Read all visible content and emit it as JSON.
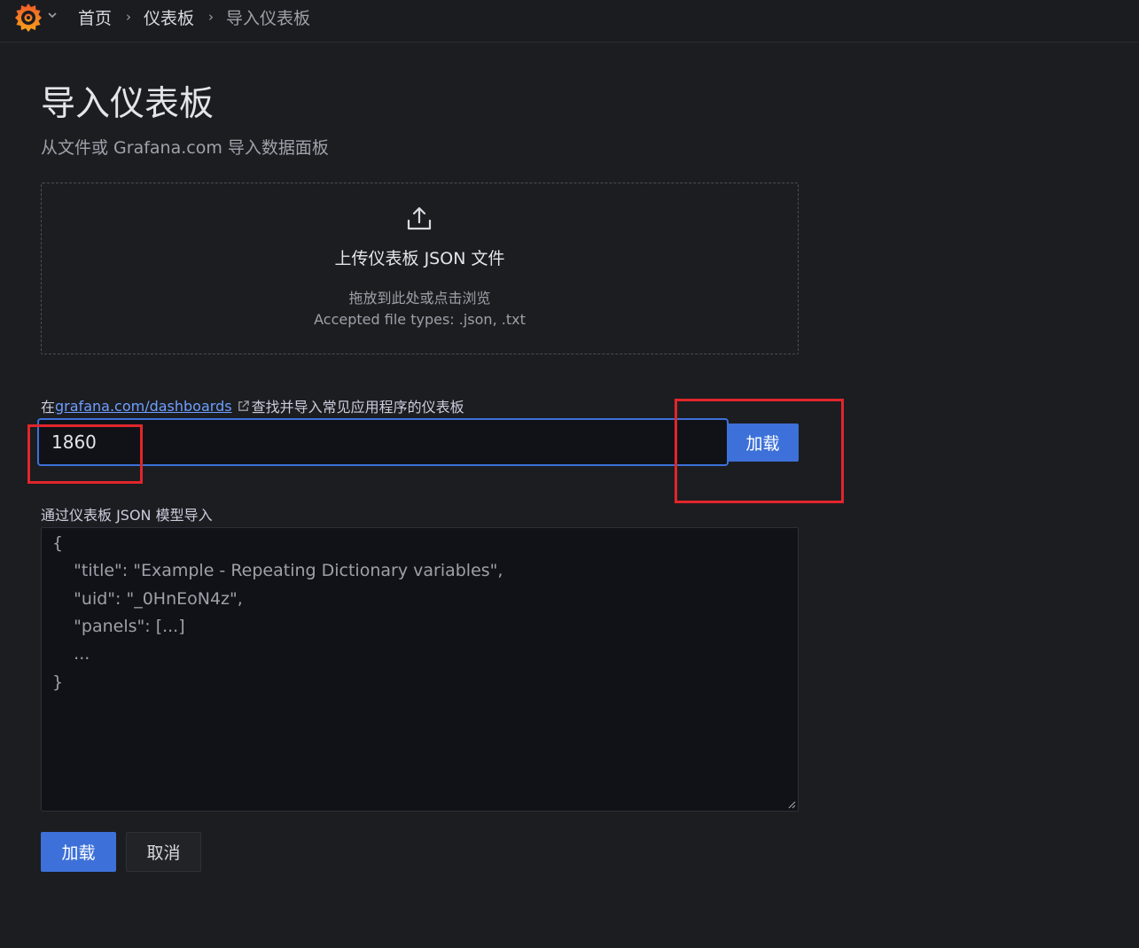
{
  "breadcrumb": {
    "items": [
      "首页",
      "仪表板",
      "导入仪表板"
    ],
    "separator": "›"
  },
  "page": {
    "title": "导入仪表板",
    "subtitle": "从文件或 Grafana.com 导入数据面板"
  },
  "upload": {
    "icon": "upload-icon",
    "title": "上传仪表板 JSON 文件",
    "hint": "拖放到此处或点击浏览",
    "accepted_types": "Accepted file types: .json, .txt"
  },
  "gcom": {
    "prefix": "在",
    "link_text": "grafana.com/dashboards",
    "suffix": "查找并导入常见应用程序的仪表板",
    "input_value": "1860",
    "load_label": "加载"
  },
  "json_model": {
    "label": "通过仪表板 JSON 模型导入",
    "placeholder_lines": [
      "{",
      "    \"title\": \"Example - Repeating Dictionary variables\",",
      "    \"uid\": \"_0HnEoN4z\",",
      "    \"panels\": [...]",
      "    ...",
      "}"
    ]
  },
  "actions": {
    "load_label": "加载",
    "cancel_label": "取消"
  },
  "colors": {
    "background": "#1c1d21",
    "primary": "#3d71d9",
    "link": "#6e9fff",
    "annotation": "#e0262b"
  }
}
